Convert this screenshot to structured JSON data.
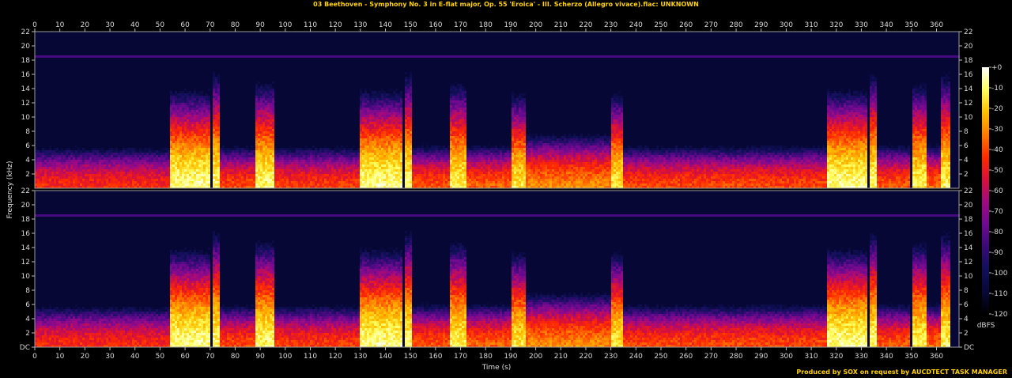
{
  "chart_data": {
    "type": "heatmap",
    "title": "03 Beethoven - Symphony No. 3 in E-flat major, Op. 55 'Eroica' - III. Scherzo (Allegro vivace).flac: UNKNOWN",
    "xlabel": "Time (s)",
    "ylabel": "Frequency (kHz)",
    "xlim": [
      0,
      369
    ],
    "ylim": [
      0,
      22
    ],
    "x_ticks": [
      0,
      10,
      20,
      30,
      40,
      50,
      60,
      70,
      80,
      90,
      100,
      110,
      120,
      130,
      140,
      150,
      160,
      170,
      180,
      190,
      200,
      210,
      220,
      230,
      240,
      250,
      260,
      270,
      280,
      290,
      300,
      310,
      320,
      330,
      340,
      350,
      360
    ],
    "y_ticks": [
      "DC",
      "2",
      "4",
      "6",
      "8",
      "10",
      "12",
      "14",
      "16",
      "18",
      "20",
      "22"
    ],
    "channels": 2,
    "colorbar": {
      "label": "dBFS",
      "ticks": [
        "+0",
        "-10",
        "-20",
        "-30",
        "-40",
        "-50",
        "-60",
        "-70",
        "-80",
        "-90",
        "-100",
        "-110",
        "-120"
      ],
      "range": [
        -120,
        0
      ]
    },
    "palette": [
      "#000000",
      "#08083a",
      "#10105a",
      "#3a0a78",
      "#6e0a90",
      "#a00a80",
      "#d8103a",
      "#ff2a00",
      "#ff7a00",
      "#ffc000",
      "#ffff60",
      "#ffffff"
    ],
    "background_level_db": -110,
    "hum_line_khz": 18.6,
    "hum_line_db": -85,
    "segments": [
      {
        "t0": 0,
        "t1": 54,
        "peak_db": -45,
        "fmax_khz": 5
      },
      {
        "t0": 54,
        "t1": 70,
        "peak_db": -8,
        "fmax_khz": 10
      },
      {
        "t0": 71,
        "t1": 74,
        "peak_db": -10,
        "fmax_khz": 12
      },
      {
        "t0": 74,
        "t1": 88,
        "peak_db": -40,
        "fmax_khz": 5
      },
      {
        "t0": 88,
        "t1": 96,
        "peak_db": -10,
        "fmax_khz": 11
      },
      {
        "t0": 96,
        "t1": 130,
        "peak_db": -42,
        "fmax_khz": 5
      },
      {
        "t0": 130,
        "t1": 147,
        "peak_db": -8,
        "fmax_khz": 10
      },
      {
        "t0": 148,
        "t1": 151,
        "peak_db": -10,
        "fmax_khz": 12
      },
      {
        "t0": 151,
        "t1": 166,
        "peak_db": -38,
        "fmax_khz": 5
      },
      {
        "t0": 166,
        "t1": 172,
        "peak_db": -12,
        "fmax_khz": 11
      },
      {
        "t0": 172,
        "t1": 190,
        "peak_db": -36,
        "fmax_khz": 5
      },
      {
        "t0": 190,
        "t1": 196,
        "peak_db": -14,
        "fmax_khz": 10
      },
      {
        "t0": 196,
        "t1": 230,
        "peak_db": -30,
        "fmax_khz": 6
      },
      {
        "t0": 230,
        "t1": 235,
        "peak_db": -14,
        "fmax_khz": 10
      },
      {
        "t0": 235,
        "t1": 316,
        "peak_db": -40,
        "fmax_khz": 5
      },
      {
        "t0": 316,
        "t1": 332,
        "peak_db": -8,
        "fmax_khz": 10
      },
      {
        "t0": 333,
        "t1": 336,
        "peak_db": -10,
        "fmax_khz": 12
      },
      {
        "t0": 336,
        "t1": 349,
        "peak_db": -38,
        "fmax_khz": 5
      },
      {
        "t0": 350,
        "t1": 356,
        "peak_db": -12,
        "fmax_khz": 11
      },
      {
        "t0": 356,
        "t1": 362,
        "peak_db": -35,
        "fmax_khz": 5
      },
      {
        "t0": 362,
        "t1": 366,
        "peak_db": -12,
        "fmax_khz": 12
      }
    ]
  },
  "footer": "Produced by SOX on request by AUCDTECT TASK MANAGER"
}
